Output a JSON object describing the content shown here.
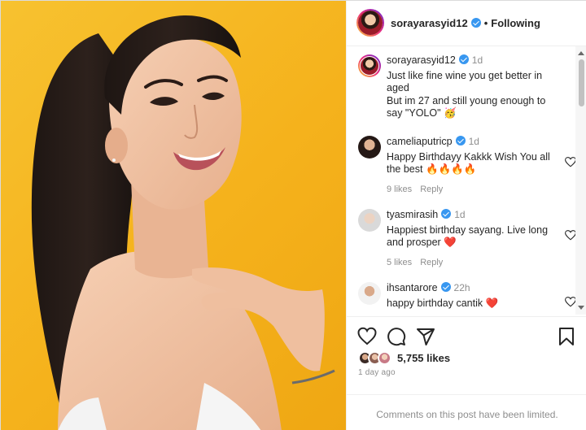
{
  "header": {
    "username": "sorayarasyid12",
    "separator": "•",
    "follow_state": "Following"
  },
  "caption": {
    "username": "sorayarasyid12",
    "time": "1d",
    "lines": [
      "Just like fine wine you get better in aged",
      "But im 27 and still young enough to say \"YOLO\" 🥳"
    ]
  },
  "comments": [
    {
      "username": "cameliaputricp",
      "time": "1d",
      "text": "Happy Birthdayy Kakkk Wish You all the best 🔥🔥🔥🔥",
      "likes": "9 likes",
      "reply": "Reply"
    },
    {
      "username": "tyasmirasih",
      "time": "1d",
      "text": "Happiest birthday sayang. Live long and prosper ❤️",
      "likes": "5 likes",
      "reply": "Reply"
    },
    {
      "username": "ihsantarore",
      "time": "22h",
      "text": "happy birthday cantik ❤️"
    }
  ],
  "actions": {
    "like_icon": "heart-outline-icon",
    "comment_icon": "comment-bubble-icon",
    "share_icon": "paper-plane-icon",
    "save_icon": "bookmark-icon"
  },
  "likes_count": "5,755 likes",
  "posted_ago": "1 day ago",
  "comments_limited_notice": "Comments on this post have been limited.",
  "colors": {
    "background_photo": "#f5b21c",
    "verified": "#3897f0",
    "muted_text": "#8e8e8e",
    "heart_red": "#ed4956"
  }
}
